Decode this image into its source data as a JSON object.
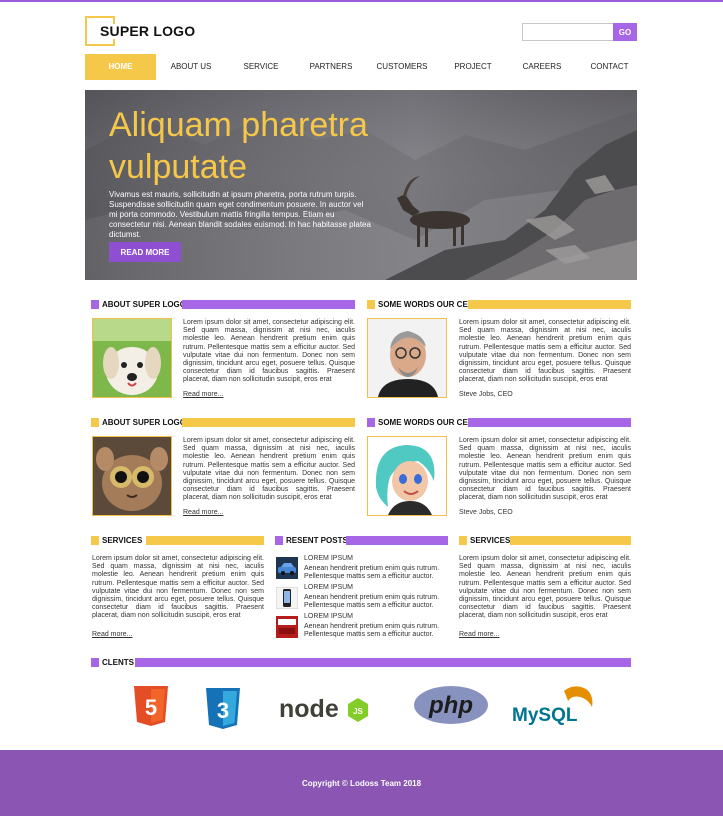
{
  "header": {
    "logo": "SUPER LOGO",
    "search_placeholder": "",
    "search_button": "GO"
  },
  "nav": {
    "items": [
      "HOME",
      "ABOUT US",
      "SERVICE",
      "PARTNERS",
      "CUSTOMERS",
      "PROJECT",
      "CAREERS",
      "CONTACT"
    ],
    "active": "HOME"
  },
  "hero": {
    "title_line1": "Aliquam pharetra",
    "title_line2": "vulputate",
    "text": "Vivamus est mauris, sollicitudin at ipsum pharetra, porta rutrum turpis. Suspendisse sollicitudin quam eget condimentum posuere. In auctor vel mi porta commodo. Vestibulum mattis fringilla tempus. Etiam eu consectetur nisi. Aenean blandit sodales euismod. In hac habitasse platea dictumst.",
    "button": "READ MORE"
  },
  "lorem": "Lorem ipsum dolor sit amet, consectetur adipiscing elit. Sed quam massa, dignissim at nisi nec, iaculis molestie leo. Aenean hendrerit pretium enim quis rutrum. Pellentesque mattis sem a efficitur auctor. Sed vulputate vitae dui non fermentum. Donec non sem dignissim, tincidunt arcu eget, posuere tellus. Quisque consectetur diam id faucibus sagittis. Praesent placerat, diam non sollicitudin suscipit, eros erat",
  "read_more": "Read more...",
  "row1": {
    "left": {
      "heading": "ABOUT SUPER LOGO",
      "image": "puppy-photo"
    },
    "right": {
      "heading": "SOME WORDS OUR CEO",
      "image": "ceo-photo",
      "caption": "Steve Jobs, CEO"
    }
  },
  "row2": {
    "left": {
      "heading": "ABOUT SUPER LOGO",
      "image": "tarsier-photo"
    },
    "right": {
      "heading": "SOME WORDS OUR CEO",
      "image": "cartoon-girl-photo",
      "caption": "Steve Jobs, CEO"
    }
  },
  "row3": {
    "services_left": {
      "heading": "SERVICES"
    },
    "posts": {
      "heading": "RESENT POSTS",
      "items": [
        {
          "title": "LOREM IPSUM",
          "text": "Aenean hendrerit pretium enim quis rutrum. Pellentesque mattis sem a efficitur auctor.",
          "icon": "car-icon"
        },
        {
          "title": "LOREM IPSUM",
          "text": "Aenean hendrerit pretium enim quis rutrum. Pellentesque mattis sem a efficitur auctor.",
          "icon": "phone-icon"
        },
        {
          "title": "LOREM IPSUM",
          "text": "Aenean hendrerit pretium enim quis rutrum. Pellentesque mattis sem a efficitur auctor.",
          "icon": "bbc-news-icon"
        }
      ]
    },
    "services_right": {
      "heading": "SERVICES"
    }
  },
  "clients": {
    "heading": "CLENTS",
    "logos": [
      "html5-logo",
      "css3-logo",
      "nodejs-logo",
      "php-logo",
      "mysql-logo"
    ],
    "html5_mark": "5",
    "css3_mark": "3",
    "node_word": "node",
    "node_js": "JS",
    "php_word": "php",
    "mysql_word": "MySQL"
  },
  "footer": {
    "text": "Copyright © Lodoss Team  2018"
  },
  "colors": {
    "accent_purple": "#a666e6",
    "accent_yellow": "#f6c84a",
    "footer": "#8a55b3"
  }
}
